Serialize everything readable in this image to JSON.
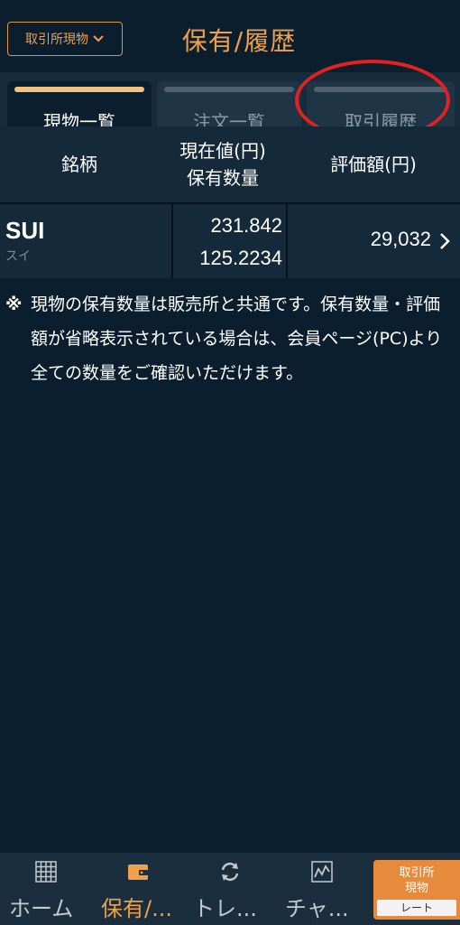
{
  "header": {
    "mode_button": "取引所現物",
    "title": "保有/履歴"
  },
  "tabs": [
    {
      "label": "現物一覧",
      "active": true
    },
    {
      "label": "注文一覧",
      "active": false
    },
    {
      "label": "取引履歴",
      "active": false
    }
  ],
  "table": {
    "col_symbol": "銘柄",
    "col_price_line1": "現在値(円)",
    "col_price_line2": "保有数量",
    "col_value": "評価額(円)",
    "rows": [
      {
        "symbol": "SUI",
        "symbol_sub": "スイ",
        "price": "231.842",
        "quantity": "125.2234",
        "value": "29,032"
      }
    ]
  },
  "note": {
    "mark": "※",
    "text": "現物の保有数量は販売所と共通です。保有数量・評価額が省略表示されている場合は、会員ページ(PC)より全ての数量をご確認いただけます。"
  },
  "nav": {
    "items": [
      {
        "label": "ホーム",
        "icon": "grid-icon",
        "active": false
      },
      {
        "label": "保有/...",
        "icon": "wallet-icon",
        "active": true
      },
      {
        "label": "トレ...",
        "icon": "refresh-icon",
        "active": false
      },
      {
        "label": "チャ...",
        "icon": "chart-icon",
        "active": false
      }
    ],
    "rate_button": {
      "line1": "取引所",
      "line2": "現物",
      "line3": "レート"
    }
  },
  "colors": {
    "accent": "#f0a04a",
    "background": "#0b1e2d",
    "annotation": "#e22222"
  }
}
